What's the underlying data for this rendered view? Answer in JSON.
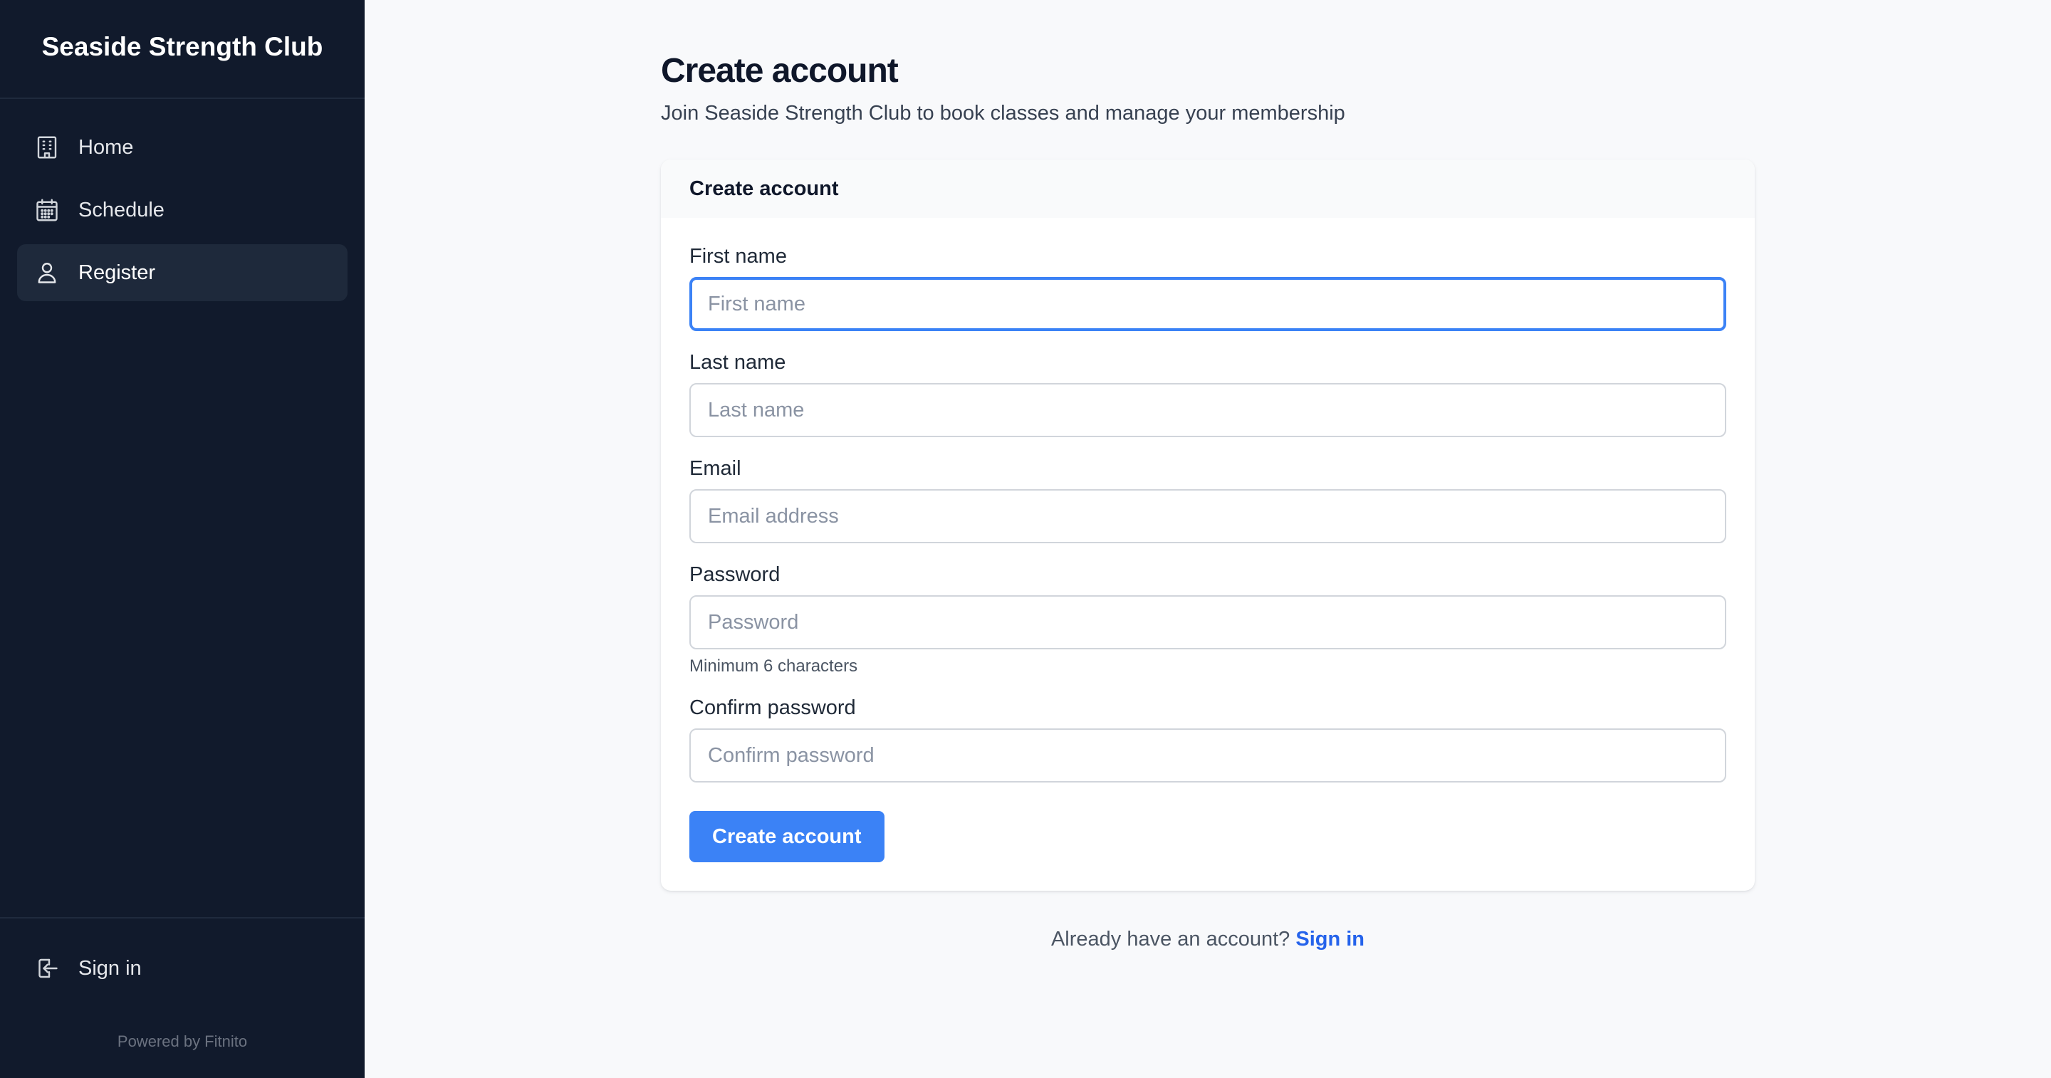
{
  "sidebar": {
    "brand": "Seaside Strength Club",
    "items": [
      {
        "label": "Home",
        "icon": "building-icon",
        "active": false
      },
      {
        "label": "Schedule",
        "icon": "calendar-icon",
        "active": false
      },
      {
        "label": "Register",
        "icon": "user-icon",
        "active": true
      }
    ],
    "footer": {
      "signin_label": "Sign in",
      "signin_icon": "sign-in-icon",
      "powered_by": "Powered by Fitnito"
    }
  },
  "main": {
    "title": "Create account",
    "subtitle": "Join Seaside Strength Club to book classes and manage your membership",
    "card": {
      "header": "Create account",
      "fields": {
        "first_name": {
          "label": "First name",
          "placeholder": "First name",
          "value": "",
          "focused": true
        },
        "last_name": {
          "label": "Last name",
          "placeholder": "Last name",
          "value": ""
        },
        "email": {
          "label": "Email",
          "placeholder": "Email address",
          "value": ""
        },
        "password": {
          "label": "Password",
          "placeholder": "Password",
          "value": "",
          "hint": "Minimum 6 characters"
        },
        "confirm_password": {
          "label": "Confirm password",
          "placeholder": "Confirm password",
          "value": ""
        }
      },
      "submit_label": "Create account"
    },
    "footer": {
      "prompt": "Already have an account?",
      "link": "Sign in"
    }
  },
  "colors": {
    "sidebar_bg": "#111a2c",
    "active_item_bg": "#1e293b",
    "accent": "#3b82f6",
    "link": "#2563eb",
    "page_bg": "#f8f9fb"
  }
}
